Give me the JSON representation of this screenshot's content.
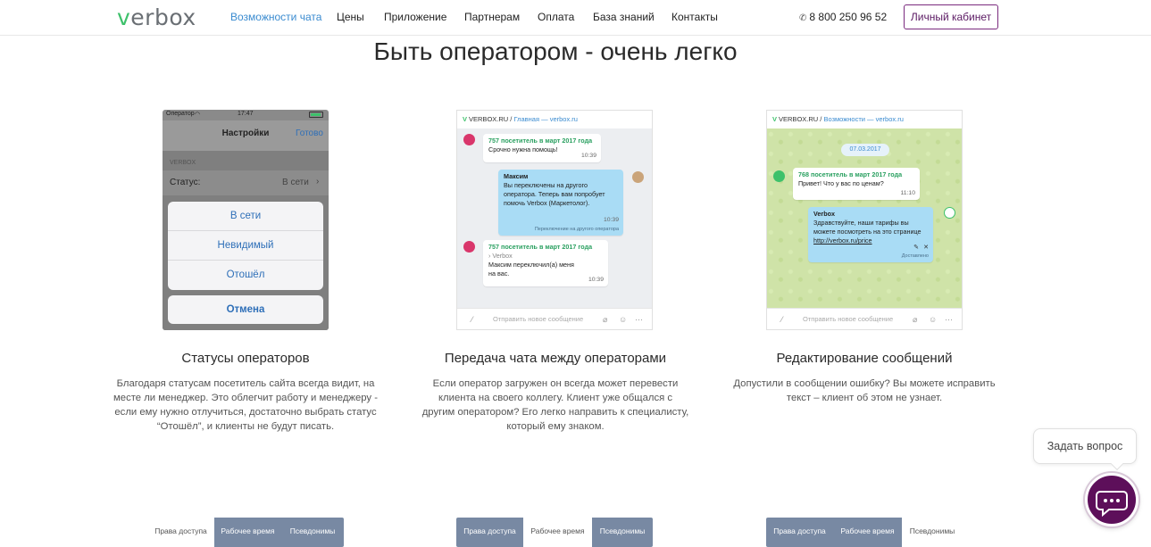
{
  "header": {
    "logo": "verbox",
    "nav": [
      "Возможности чата",
      "Цены",
      "Приложение",
      "Партнерам",
      "Оплата",
      "База знаний",
      "Контакты"
    ],
    "phone": "8 800 250 96 52",
    "cabinet_button": "Личный кабинет"
  },
  "page_title": "Быть оператором - очень легко",
  "cards": [
    {
      "title": "Статусы операторов",
      "text": "Благодаря статусам посетитель сайта всегда видит, на месте ли менеджер. Это облегчит работу и менеджеру - если ему нужно отлучиться, достаточно выбрать статус “Отошёл”, и клиенты не будут писать."
    },
    {
      "title": "Передача чата между операторами",
      "text": "Если оператор загружен он всегда может перевести клиента на своего коллегу. Клиент уже общался с другим оператором? Его легко направить к специалисту, который ему знаком."
    },
    {
      "title": "Редактирование сообщений",
      "text": "Допустили в сообщении ошибку? Вы можете исправить текст – клиент об этом не узнает."
    }
  ],
  "ios": {
    "carrier": "Оператор",
    "time": "17:47",
    "nav_title": "Настройки",
    "nav_done": "Готово",
    "section": "VERBOX",
    "status_label": "Статус:",
    "status_value": "В сети",
    "sheet_options": [
      "В сети",
      "Невидимый",
      "Отошёл"
    ],
    "cancel": "Отмена"
  },
  "chat1": {
    "site": "VERBOX.RU",
    "sep": "/",
    "link": "Главная — verbox.ru",
    "msg1_head": "757 посетитель в март 2017 года",
    "msg1_text": "Срочно нужна помощь!",
    "msg1_time": "10:39",
    "msg2_name": "Максим",
    "msg2_text": "Вы переключены на другого оператора. Теперь вам попробует помочь Verbox (Маркетолог).",
    "msg2_time": "10:39",
    "msg2_note": "Переключение на другого оператора",
    "msg3_head": "757 посетитель в март 2017 года",
    "msg3_quote": "Verbox",
    "msg3_text": "Максим переключил(а) меня на вас.",
    "msg3_time": "10:39",
    "input_placeholder": "Отправить новое сообщение"
  },
  "chat2": {
    "site": "VERBOX.RU",
    "sep": "/",
    "link": "Возможности — verbox.ru",
    "date": "07.03.2017",
    "msg1_head": "768 посетитель в март 2017 года",
    "msg1_text": "Привет! Что у вас по ценам?",
    "msg1_time": "11:10",
    "msg2_name": "Verbox",
    "msg2_text": "Здравствуйте, наши тарифы вы можете посмотреть на это странице",
    "msg2_link": "http://verbox.ru/price",
    "msg2_status": "Доставлено",
    "input_placeholder": "Отправить новое сообщение"
  },
  "tabs": [
    [
      "Права доступа",
      "Рабочее время",
      "Псевдонимы"
    ],
    [
      "Права доступа",
      "Рабочее время",
      "Псевдонимы"
    ],
    [
      "Права доступа",
      "Рабочее время",
      "Псевдонимы"
    ]
  ],
  "widget": {
    "ask_label": "Задать вопрос"
  },
  "colors": {
    "accent_purple": "#5d0f5a",
    "link_blue": "#3a8bd0",
    "brand_green": "#3ec16b",
    "tab_gray": "#7889a3"
  }
}
